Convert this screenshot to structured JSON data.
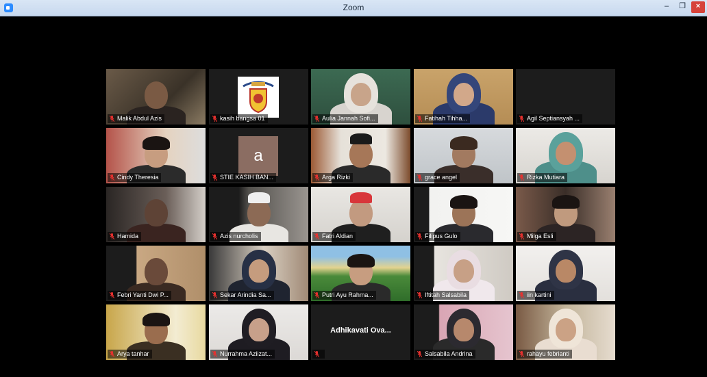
{
  "window": {
    "title": "Zoom",
    "minimize": "–",
    "maximize": "❐",
    "close": "×"
  },
  "participants": [
    {
      "name": "Malik Abdul Azis",
      "scene": "room-dark",
      "active": true
    },
    {
      "name": "kasih bangsa 01",
      "scene": "logo"
    },
    {
      "name": "Aulia Jannah Sofi...",
      "scene": "hijab-glasses-green"
    },
    {
      "name": "Fatihah Tihha...",
      "scene": "hijab-patterned"
    },
    {
      "name": "Agil Septiansyah ...",
      "scene": "video-off"
    },
    {
      "name": "Cindy Theresia",
      "scene": "girl-red-room"
    },
    {
      "name": "STIE KASIH BAN...",
      "scene": "avatar",
      "avatar_letter": "a"
    },
    {
      "name": "Arga Rizki",
      "scene": "cap-boy"
    },
    {
      "name": "grace angel",
      "scene": "shelf-girl"
    },
    {
      "name": "Rizka Mutiara",
      "scene": "hijab-teal"
    },
    {
      "name": "Hamida",
      "scene": "dark-corner"
    },
    {
      "name": "Azis nurcholis",
      "scene": "kopiah-boy"
    },
    {
      "name": "Fatri Aldian",
      "scene": "fez-boy"
    },
    {
      "name": "Filipus Gulo",
      "scene": "boy-white-wall"
    },
    {
      "name": "Milga Esli",
      "scene": "girl-dark-room"
    },
    {
      "name": "Febri Yanti Dwi P...",
      "scene": "warm-wall"
    },
    {
      "name": "Sekar Arindia Sa...",
      "scene": "hijab-glasses-room"
    },
    {
      "name": "Putri Ayu Rahma...",
      "scene": "landscape-bg"
    },
    {
      "name": "Iftitah Salsabila",
      "scene": "hijab-window"
    },
    {
      "name": "iin kartini",
      "scene": "hijab-bright"
    },
    {
      "name": "Arya tanhar",
      "scene": "boy-yellow"
    },
    {
      "name": "Nurrahma Aziizat...",
      "scene": "hijab-plain"
    },
    {
      "name": "Adhikavati  Ova...",
      "scene": "name-only"
    },
    {
      "name": "Salsabila Andrina",
      "scene": "hijab-pink"
    },
    {
      "name": "rahayu febrianti",
      "scene": "hijab-glasses-light"
    }
  ],
  "colors": {
    "active_border": "#c3e26b",
    "muted_icon": "#e8312f",
    "tile_bg": "#1c1c1c",
    "stage_bg": "#000000"
  }
}
